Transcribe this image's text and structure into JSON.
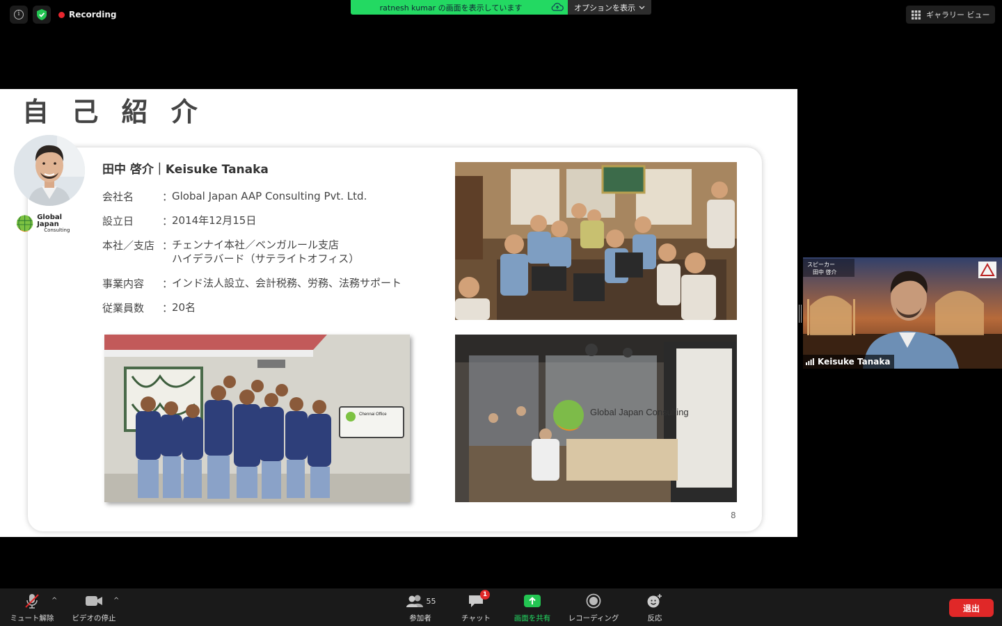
{
  "topbar": {
    "recording_label": "Recording",
    "share_banner": "ratnesh kumar の画面を表示しています",
    "options_label": "オプションを表示",
    "gallery_label": "ギャラリー ビュー"
  },
  "slide": {
    "title": "自 己 紹 介",
    "logo": {
      "line1": "Global Japan",
      "line2": "Consulting"
    },
    "name": "田中 啓介｜Keisuke Tanaka",
    "rows": [
      {
        "label": "会社名",
        "sep": "：",
        "value": "Global Japan AAP Consulting Pvt. Ltd."
      },
      {
        "label": "設立日",
        "sep": "：",
        "value": "2014年12月15日"
      },
      {
        "label": "本社／支店",
        "sep": "：",
        "value": "チェンナイ本社／ベンガルール支店",
        "value2": "ハイデラバード（サテライトオフィス）"
      },
      {
        "label": "事業内容",
        "sep": "：",
        "value": "インド法人設立、会計税務、労務、法務サポート"
      },
      {
        "label": "従業員数",
        "sep": "：",
        "value": "20名"
      }
    ],
    "office_sign": "Global Japan Consulting",
    "chennai_sign": "Chennai Office",
    "page_number": "8"
  },
  "speaker": {
    "name": "Keisuke Tanaka",
    "banner_line1": "スピーカー",
    "banner_line2": "田中 啓介"
  },
  "toolbar": {
    "mute_label": "ミュート解除",
    "video_label": "ビデオの停止",
    "participants_label": "参加者",
    "participants_count": "55",
    "chat_label": "チャット",
    "chat_badge": "1",
    "share_label": "画面を共有",
    "record_label": "レコーディング",
    "reactions_label": "反応",
    "leave_label": "退出"
  },
  "colors": {
    "share_green": "#23d962",
    "leave_red": "#e02828",
    "record_red": "#e8262e"
  }
}
